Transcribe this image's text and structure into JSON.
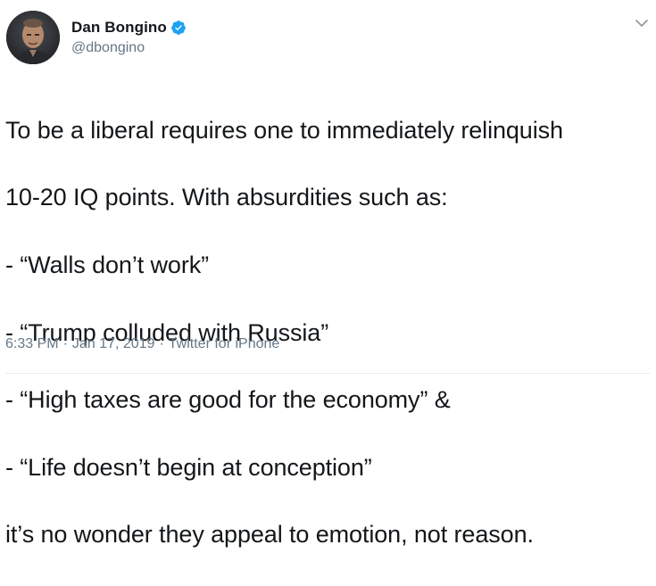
{
  "tweet": {
    "author": {
      "display_name": "Dan Bongino",
      "handle": "@dbongino",
      "verified": true,
      "avatar_icon": "profile-photo",
      "verified_icon": "verified-badge-icon"
    },
    "menu_icon": "chevron-down-icon",
    "text_lines": [
      "To be a liberal requires one to immediately relinquish",
      "10-20 IQ points. With absurdities such as:",
      "- “Walls don’t work”",
      "- “Trump colluded with Russia”",
      "- “High taxes are good for the economy” &",
      "- “Life doesn’t begin at conception”",
      "it’s no wonder they appeal to emotion, not reason."
    ],
    "meta": {
      "time": "6:33 PM",
      "separator": "·",
      "date": "Jan 17, 2019",
      "source": "Twitter for iPhone"
    }
  },
  "colors": {
    "text": "#14171a",
    "secondary": "#657786",
    "verified": "#1da1f2",
    "divider": "#e6ecf0"
  }
}
